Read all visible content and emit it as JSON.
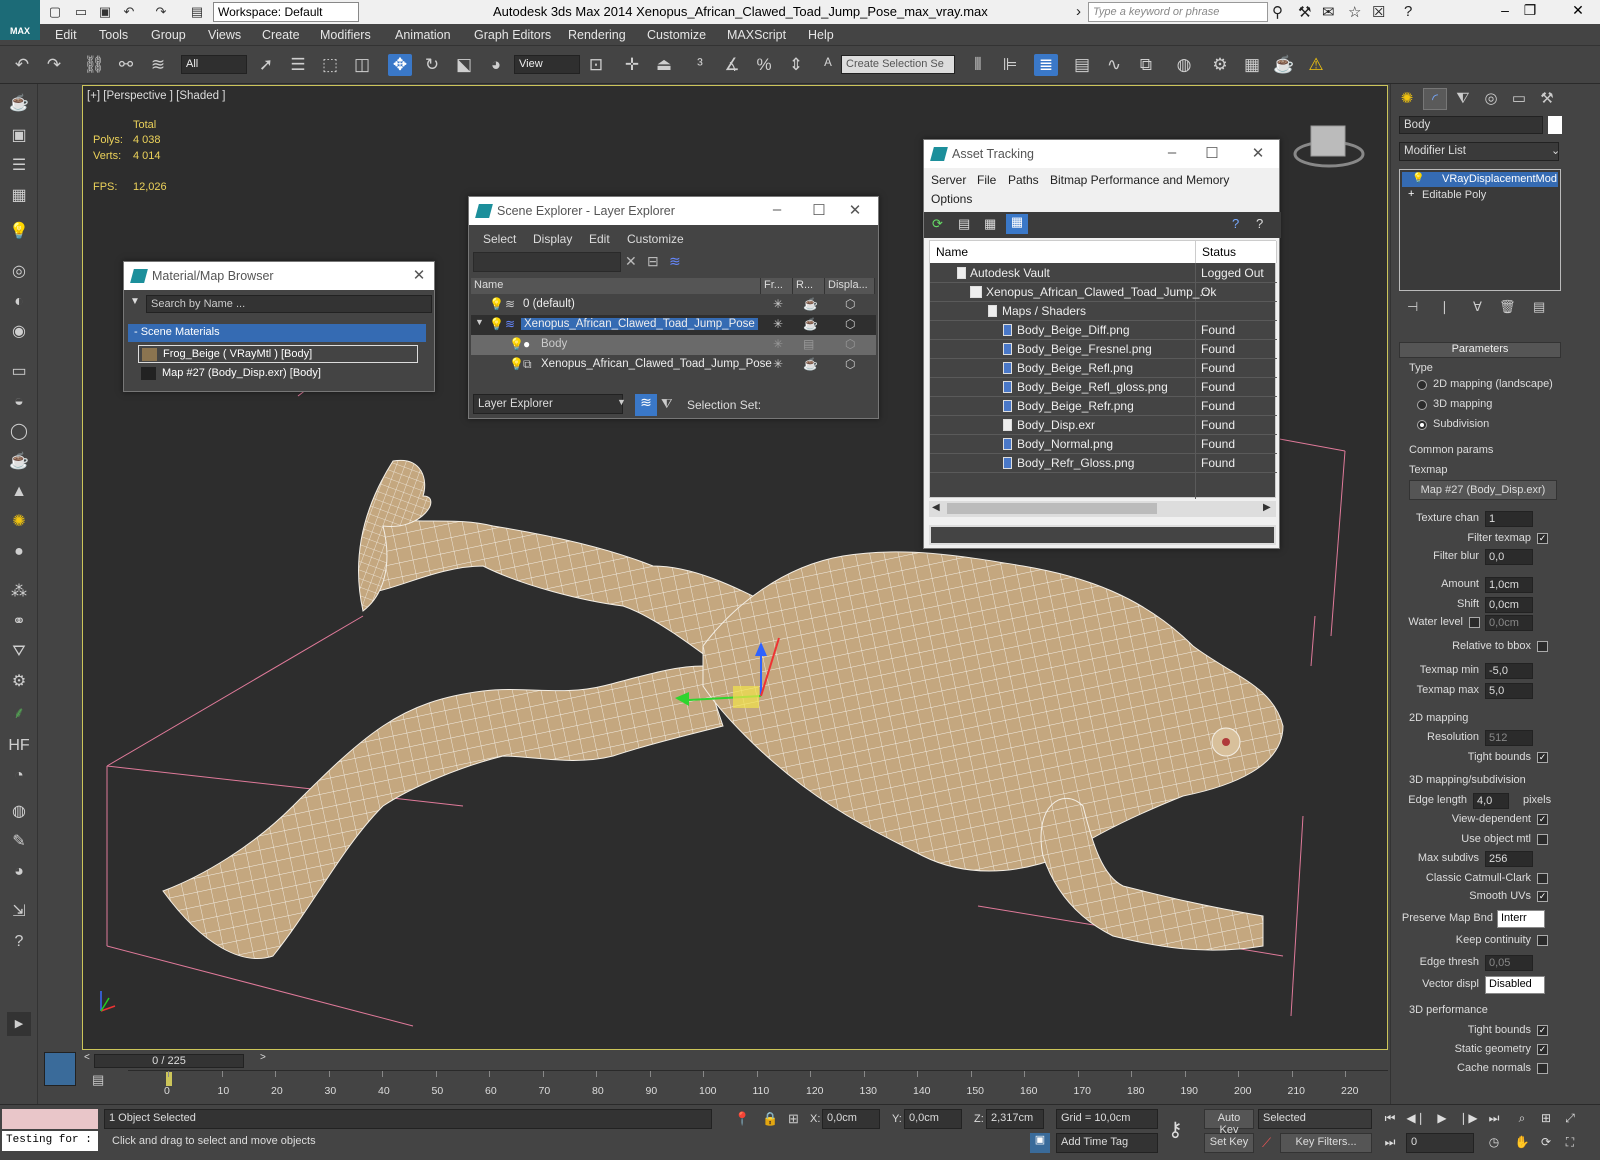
{
  "app": {
    "logo": "MAX",
    "workspace": "Workspace: Default",
    "title": "Autodesk 3ds Max  2014    Xenopus_African_Clawed_Toad_Jump_Pose_max_vray.max",
    "search_placeholder": "Type a keyword or phrase"
  },
  "menu": [
    "Edit",
    "Tools",
    "Group",
    "Views",
    "Create",
    "Modifiers",
    "Animation",
    "Graph Editors",
    "Rendering",
    "Customize",
    "MAXScript",
    "Help"
  ],
  "toolbar": {
    "filter_value": "All",
    "view_value": "View",
    "selection_set_placeholder": "Create Selection Se"
  },
  "viewport": {
    "label": "[+] [Perspective ] [Shaded ]",
    "stats": {
      "total_label": "Total",
      "polys_label": "Polys:",
      "polys_value": "4 038",
      "verts_label": "Verts:",
      "verts_value": "4 014",
      "fps_label": "FPS:",
      "fps_value": "12,026"
    }
  },
  "material_browser": {
    "title": "Material/Map Browser",
    "search_placeholder": "Search by Name ...",
    "section": "- Scene Materials",
    "items": [
      "Frog_Beige  ( VRayMtl )  [Body]",
      "Map #27 (Body_Disp.exr)  [Body]"
    ]
  },
  "scene_explorer": {
    "title": "Scene Explorer - Layer Explorer",
    "menu": [
      "Select",
      "Display",
      "Edit",
      "Customize"
    ],
    "columns": [
      "Name",
      "Fr...",
      "R...",
      "Displa..."
    ],
    "rows": [
      "0 (default)",
      "Xenopus_African_Clawed_Toad_Jump_Pose",
      "Body",
      "Xenopus_African_Clawed_Toad_Jump_Pose"
    ],
    "mode": "Layer Explorer",
    "selection_set_label": "Selection Set:"
  },
  "asset_tracking": {
    "title": "Asset Tracking",
    "menu": [
      "Server",
      "File",
      "Paths",
      "Bitmap Performance and Memory",
      "Options"
    ],
    "columns": [
      "Name",
      "Status"
    ],
    "rows": [
      {
        "name": "Autodesk Vault",
        "status": "Logged Out ..."
      },
      {
        "name": "Xenopus_African_Clawed_Toad_Jump_...",
        "status": "Ok"
      },
      {
        "name": "Maps / Shaders",
        "status": ""
      },
      {
        "name": "Body_Beige_Diff.png",
        "status": "Found"
      },
      {
        "name": "Body_Beige_Fresnel.png",
        "status": "Found"
      },
      {
        "name": "Body_Beige_Refl.png",
        "status": "Found"
      },
      {
        "name": "Body_Beige_Refl_gloss.png",
        "status": "Found"
      },
      {
        "name": "Body_Beige_Refr.png",
        "status": "Found"
      },
      {
        "name": "Body_Disp.exr",
        "status": "Found"
      },
      {
        "name": "Body_Normal.png",
        "status": "Found"
      },
      {
        "name": "Body_Refr_Gloss.png",
        "status": "Found"
      }
    ]
  },
  "command_panel": {
    "object_name": "Body",
    "modifier_list": "Modifier List",
    "stack": [
      "VRayDisplacementMod",
      "Editable Poly"
    ],
    "rollout_title": "Parameters",
    "type_label": "Type",
    "type_options": [
      "2D mapping (landscape)",
      "3D mapping",
      "Subdivision"
    ],
    "common_params": "Common params",
    "texmap_label": "Texmap",
    "texmap_value": "Map #27 (Body_Disp.exr)",
    "texture_chan_label": "Texture chan",
    "texture_chan_value": "1",
    "filter_texmap_label": "Filter texmap",
    "filter_blur_label": "Filter blur",
    "filter_blur_value": "0,0",
    "amount_label": "Amount",
    "amount_value": "1,0cm",
    "shift_label": "Shift",
    "shift_value": "0,0cm",
    "water_level_label": "Water level",
    "water_level_value": "0,0cm",
    "relative_bbox_label": "Relative to bbox",
    "texmap_min_label": "Texmap min",
    "texmap_min_value": "-5,0",
    "texmap_max_label": "Texmap max",
    "texmap_max_value": "5,0",
    "mapping2d": "2D mapping",
    "resolution_label": "Resolution",
    "resolution_value": "512",
    "tight_bounds_label": "Tight bounds",
    "mapping3d": "3D mapping/subdivision",
    "edge_length_label": "Edge length",
    "edge_length_value": "4,0",
    "pixels_label": "pixels",
    "view_dependent_label": "View-dependent",
    "use_object_mtl_label": "Use object mtl",
    "max_subdivs_label": "Max subdivs",
    "max_subdivs_value": "256",
    "classic_cc_label": "Classic Catmull-Clark",
    "smooth_uvs_label": "Smooth UVs",
    "preserve_map_label": "Preserve Map Bnd",
    "preserve_map_value": "Interr",
    "keep_continuity_label": "Keep continuity",
    "edge_thresh_label": "Edge thresh",
    "edge_thresh_value": "0,05",
    "vector_displ_label": "Vector displ",
    "vector_displ_value": "Disabled",
    "perf3d": "3D performance",
    "tight_bounds2_label": "Tight bounds",
    "static_geometry_label": "Static geometry",
    "cache_normals_label": "Cache normals"
  },
  "timeline": {
    "frame_display": "0 / 225",
    "ticks": [
      "0",
      "10",
      "20",
      "30",
      "40",
      "50",
      "60",
      "70",
      "80",
      "90",
      "100",
      "110",
      "120",
      "130",
      "140",
      "150",
      "160",
      "170",
      "180",
      "190",
      "200",
      "210",
      "220"
    ]
  },
  "status": {
    "script_text": "Testing for :",
    "selected": "1 Object Selected",
    "prompt": "Click and drag to select and move objects",
    "x_label": "X:",
    "x_value": "0,0cm",
    "y_label": "Y:",
    "y_value": "0,0cm",
    "z_label": "Z:",
    "z_value": "2,317cm",
    "grid": "Grid = 10,0cm",
    "add_time_tag": "Add Time Tag",
    "auto_key": "Auto Key",
    "set_key": "Set Key",
    "key_mode": "Selected",
    "key_filters": "Key Filters...",
    "frame_value": "0"
  },
  "colors": {
    "accent": "#3a78c8",
    "viewport_bg": "#2d2d2d",
    "stats_text": "#ecd25a",
    "frog_skin": "#c9ae87"
  }
}
